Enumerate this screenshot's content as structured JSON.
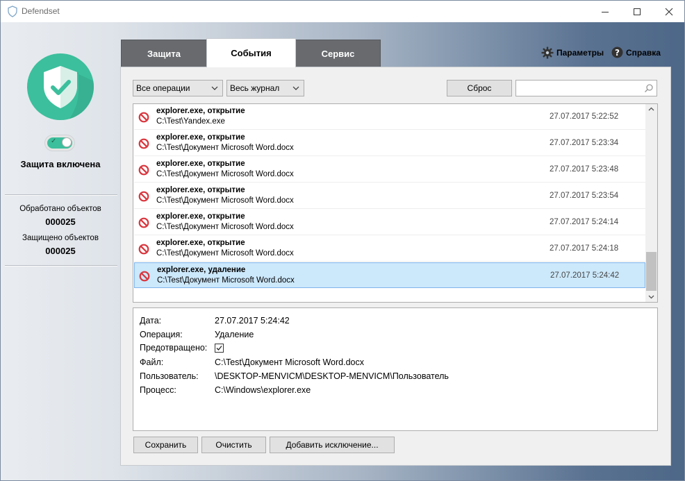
{
  "window": {
    "title": "Defendset"
  },
  "sidebar": {
    "status_label": "Защита включена",
    "toggle_on": true,
    "processed_label": "Обработано объектов",
    "processed_value": "000025",
    "protected_label": "Защищено объектов",
    "protected_value": "000025"
  },
  "tabs": [
    {
      "label": "Защита",
      "active": false
    },
    {
      "label": "События",
      "active": true
    },
    {
      "label": "Сервис",
      "active": false
    }
  ],
  "toplinks": {
    "settings": "Параметры",
    "help": "Справка"
  },
  "filters": {
    "operation": "Все операции",
    "journal": "Весь журнал",
    "reset_label": "Сброс",
    "search_placeholder": ""
  },
  "events": [
    {
      "title": "explorer.exe, открытие",
      "path": "C:\\Test\\Yandex.exe",
      "time": "27.07.2017 5:22:52",
      "selected": false
    },
    {
      "title": "explorer.exe, открытие",
      "path": "C:\\Test\\Документ Microsoft Word.docx",
      "time": "27.07.2017 5:23:34",
      "selected": false
    },
    {
      "title": "explorer.exe, открытие",
      "path": "C:\\Test\\Документ Microsoft Word.docx",
      "time": "27.07.2017 5:23:48",
      "selected": false
    },
    {
      "title": "explorer.exe, открытие",
      "path": "C:\\Test\\Документ Microsoft Word.docx",
      "time": "27.07.2017 5:23:54",
      "selected": false
    },
    {
      "title": "explorer.exe, открытие",
      "path": "C:\\Test\\Документ Microsoft Word.docx",
      "time": "27.07.2017 5:24:14",
      "selected": false
    },
    {
      "title": "explorer.exe, открытие",
      "path": "C:\\Test\\Документ Microsoft Word.docx",
      "time": "27.07.2017 5:24:18",
      "selected": false
    },
    {
      "title": "explorer.exe, удаление",
      "path": "C:\\Test\\Документ Microsoft Word.docx",
      "time": "27.07.2017 5:24:42",
      "selected": true
    }
  ],
  "details": {
    "date_label": "Дата:",
    "date_value": "27.07.2017 5:24:42",
    "operation_label": "Операция:",
    "operation_value": "Удаление",
    "prevented_label": "Предотвращено:",
    "prevented_checked": true,
    "file_label": "Файл:",
    "file_value": "C:\\Test\\Документ Microsoft Word.docx",
    "user_label": "Пользователь:",
    "user_value": "\\DESKTOP-MENVICM\\DESKTOP-MENVICM\\Пользователь",
    "process_label": "Процесс:",
    "process_value": "C:\\Windows\\explorer.exe"
  },
  "actions": {
    "save": "Сохранить",
    "clear": "Очистить",
    "add_exception": "Добавить исключение..."
  },
  "colors": {
    "accent": "#3cbf9c",
    "selection": "#cce8fb",
    "tab_inactive": "#686a6e",
    "block_icon": "#d9363e"
  }
}
